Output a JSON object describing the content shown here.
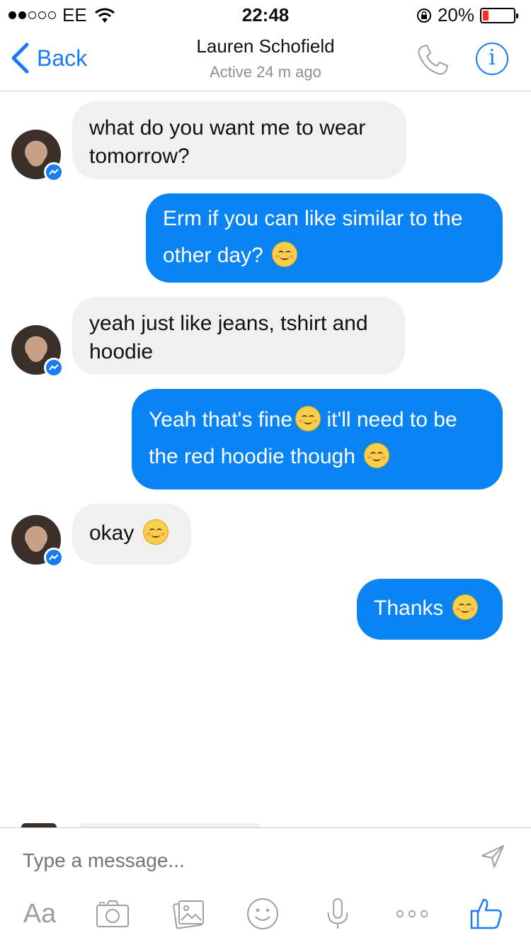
{
  "status_bar": {
    "carrier": "EE",
    "time": "22:48",
    "battery_percent": "20%",
    "battery_level": 0.2,
    "signal_bars": 2
  },
  "nav": {
    "back_label": "Back",
    "contact_name": "Lauren Schofield",
    "contact_status": "Active 24 m ago",
    "info_glyph": "i"
  },
  "messages": [
    {
      "sender": "them",
      "text": "what do you want me to wear tomorrow?"
    },
    {
      "sender": "me",
      "text": "Erm if you can like similar to the other day?",
      "emoji": "relieved-face"
    },
    {
      "sender": "them",
      "text": "yeah just like jeans, tshirt and hoodie"
    },
    {
      "sender": "me",
      "text_part1": "Yeah that's fine",
      "text_part2": " it'll need to be the red hoodie though",
      "emoji": "relieved-face"
    },
    {
      "sender": "them",
      "text": "okay",
      "emoji": "smiling-face"
    },
    {
      "sender": "me",
      "text": "Thanks",
      "emoji": "relieved-face"
    }
  ],
  "composer": {
    "placeholder": "Type a message...",
    "text_format_label": "Aa"
  },
  "colors": {
    "accent": "#1a7cf5",
    "outgoing_bubble": "#0a84f5",
    "incoming_bubble": "#f1f0f0"
  },
  "icons": [
    "back-chevron-icon",
    "phone-icon",
    "info-icon",
    "messenger-badge-icon",
    "send-icon",
    "camera-icon",
    "gallery-icon",
    "emoji-icon",
    "microphone-icon",
    "more-icon",
    "like-icon"
  ]
}
